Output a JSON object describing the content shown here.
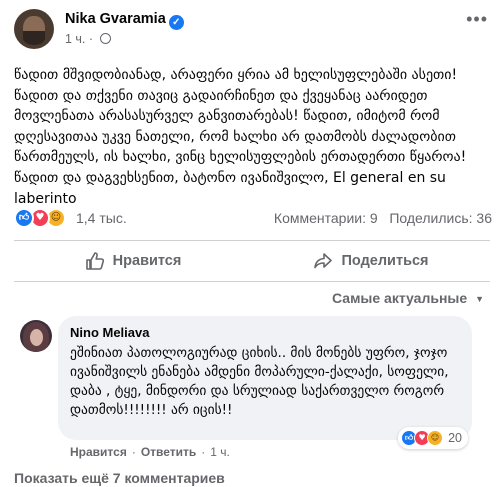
{
  "post": {
    "author": "Nika Gvaramia",
    "time": "1 ч.",
    "text": "წადით მშვიდობიანად, არაფერი ყრია ამ ხელისუფლებაში ასეთი! წადით და თქვენი თავიც გადაირჩინეთ და ქვეყანაც აარიდეთ მოვლენათა არასასურველ განვითარებას! წადით, იმიტომ რომ დღესავითაა უკვე ნათელი, რომ ხალხი არ დათმობს ძალადობით წართმეულს, ის ხალხი, ვინც ხელისუფლების ერთადერთი წყაროა! წადით და დაგვეხსენით, ბატონო ივანიშვილო, El general en su laberinto",
    "reactions_count": "1,4 тыс.",
    "comments_label": "Комментарии: 9",
    "shares_label": "Поделились: 36",
    "reactions": [
      "like",
      "love",
      "haha"
    ]
  },
  "actions": {
    "like_label": "Нравится",
    "share_label": "Поделиться"
  },
  "sort": {
    "label": "Самые актуальные"
  },
  "comment": {
    "author": "Nino Meliava",
    "text": "ეშინიათ პათოლოგიურად ციხის.. მის მონებს უფრო, ჯოჯო ივანიშვილს ენანება ამდენი მოპარული-ქალაქი, სოფელი, დაბა , ტყე, მინდორი და სრულიად საქართველო როგორ დათმოს!!!!!!!! არ იცის!!",
    "reactions_count": "20",
    "like_label": "Нравится",
    "reply_label": "Ответить",
    "time": "1 ч."
  },
  "more_comments": {
    "label": "Показать ещё 7 комментариев"
  },
  "colors": {
    "accent": "#1877f2",
    "love": "#f33e58",
    "haha": "#f7b125",
    "muted": "#65676b",
    "bubble": "#f0f2f5"
  }
}
